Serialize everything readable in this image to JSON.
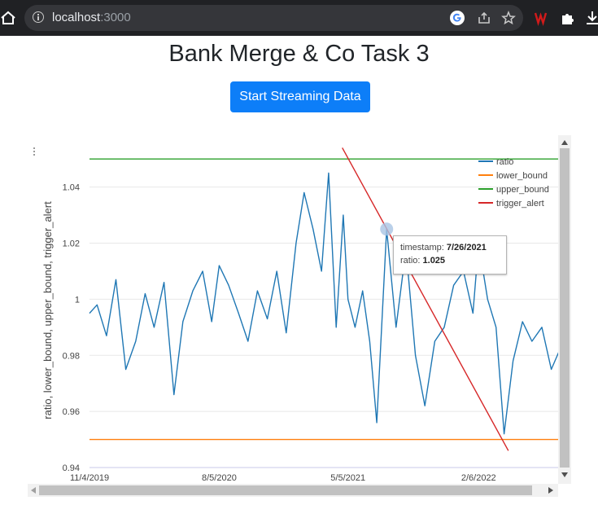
{
  "browser": {
    "url_host": "localhost",
    "url_port": ":3000"
  },
  "page": {
    "title": "Bank Merge & Co Task 3",
    "stream_button_label": "Start Streaming Data"
  },
  "tooltip": {
    "timestamp_label": "timestamp: ",
    "timestamp_value": "7/26/2021",
    "ratio_label": "ratio: ",
    "ratio_value": "1.025"
  },
  "chart_data": {
    "type": "line",
    "title": "",
    "xlabel": "",
    "ylabel": "ratio, lower_bound, upper_bound, trigger_alert",
    "x_ticks": [
      "11/4/2019",
      "8/5/2020",
      "5/5/2021",
      "2/6/2022"
    ],
    "x_range": [
      "11/4/2019",
      "7/28/2022"
    ],
    "ylim": [
      0.94,
      1.055
    ],
    "y_ticks": [
      0.94,
      0.96,
      0.98,
      1,
      1.02,
      1.04
    ],
    "y_tick_labels": [
      "0.94",
      "0.96",
      "0.98",
      "1",
      "1.02",
      "1.04"
    ],
    "grid": true,
    "legend_position": "top-right",
    "series": [
      {
        "name": "ratio",
        "color": "#1f77b4",
        "x": [
          "11/4/2019",
          "11/20/2019",
          "12/10/2019",
          "12/30/2019",
          "1/20/2020",
          "2/10/2020",
          "3/1/2020",
          "3/20/2020",
          "4/10/2020",
          "5/1/2020",
          "5/20/2020",
          "6/10/2020",
          "7/1/2020",
          "7/20/2020",
          "8/5/2020",
          "8/25/2020",
          "9/15/2020",
          "10/5/2020",
          "10/25/2020",
          "11/15/2020",
          "12/5/2020",
          "12/25/2020",
          "1/15/2021",
          "2/1/2021",
          "2/20/2021",
          "3/10/2021",
          "3/25/2021",
          "4/10/2021",
          "4/25/2021",
          "5/5/2021",
          "5/20/2021",
          "6/5/2021",
          "6/20/2021",
          "7/5/2021",
          "7/26/2021",
          "8/15/2021",
          "9/5/2021",
          "9/25/2021",
          "10/15/2021",
          "11/5/2021",
          "11/25/2021",
          "12/15/2021",
          "1/5/2022",
          "1/25/2022",
          "2/6/2022",
          "2/25/2022",
          "3/15/2022",
          "4/1/2022",
          "4/20/2022",
          "5/10/2022",
          "5/30/2022",
          "6/20/2022",
          "7/10/2022",
          "7/28/2022"
        ],
        "values": [
          0.995,
          0.998,
          0.987,
          1.007,
          0.975,
          0.985,
          1.002,
          0.99,
          1.006,
          0.966,
          0.992,
          1.003,
          1.01,
          0.992,
          1.012,
          1.005,
          0.995,
          0.985,
          1.003,
          0.993,
          1.01,
          0.988,
          1.02,
          1.038,
          1.025,
          1.01,
          1.045,
          0.99,
          1.03,
          1.0,
          0.99,
          1.003,
          0.985,
          0.956,
          1.025,
          0.99,
          1.018,
          0.98,
          0.962,
          0.985,
          0.99,
          1.005,
          1.01,
          0.995,
          1.02,
          1.0,
          0.99,
          0.952,
          0.978,
          0.992,
          0.985,
          0.99,
          0.975,
          0.982
        ]
      },
      {
        "name": "lower_bound",
        "color": "#ff7f0e",
        "x": [
          "11/4/2019",
          "7/28/2022"
        ],
        "values": [
          0.95,
          0.95
        ]
      },
      {
        "name": "upper_bound",
        "color": "#2ca02c",
        "x": [
          "11/4/2019",
          "7/28/2022"
        ],
        "values": [
          1.05,
          1.05
        ]
      },
      {
        "name": "trigger_alert",
        "color": "#d62728",
        "x": [
          "4/23/2021",
          "4/10/2022"
        ],
        "values": [
          1.054,
          0.946
        ]
      }
    ]
  }
}
